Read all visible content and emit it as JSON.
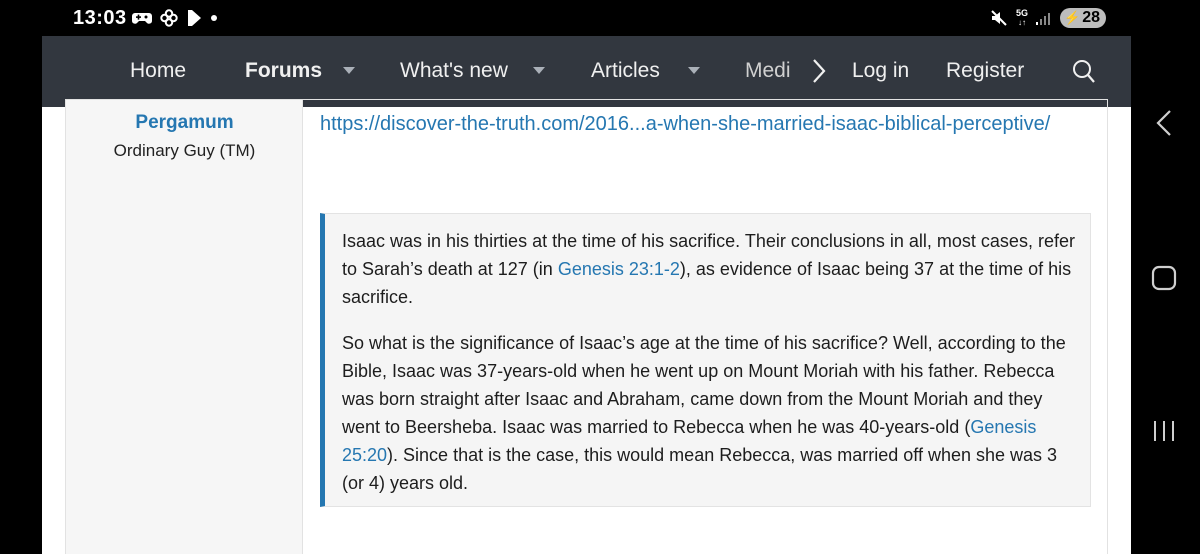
{
  "status_bar": {
    "time": "13:03",
    "notification_icons": [
      "gamepad-icon",
      "pinwheel-icon",
      "play-icon",
      "dot-icon"
    ],
    "network": "5G",
    "battery": "28"
  },
  "nav": {
    "home": "Home",
    "forums": "Forums",
    "whats_new": "What's new",
    "articles": "Articles",
    "media": "Medi",
    "login": "Log in",
    "register": "Register"
  },
  "post": {
    "username": "Pergamum",
    "user_title": "Ordinary Guy (TM)",
    "link_text": "https://discover-the-truth.com/2016...a-when-she-married-isaac-biblical-perceptive/",
    "quote": {
      "p1_a": "Isaac was in his thirties at the time of his sacrifice. Their conclusions in all, most cases, refer to Sarah’s death at 127 (in ",
      "p1_ref": "Genesis 23:1-2",
      "p1_b": "), as evidence of Isaac being 37 at the time of his sacrifice.",
      "p2_a": "So what is the significance of Isaac’s age at the time of his sacrifice? Well, according to the Bible, Isaac was 37-years-old when he went up on Mount Moriah with his father. Rebecca was born straight after Isaac and Abraham, came down from the Mount Moriah and they went to Beersheba. Isaac was married to Rebecca when he was 40-years-old (",
      "p2_ref": "Genesis 25:20",
      "p2_b": "). Since that is the case, this would mean Rebecca, was married off when she was 3 (or 4) years old."
    }
  },
  "colors": {
    "navbar_bg": "#32373f",
    "link": "#2577b1",
    "quote_bg": "#f5f5f5"
  }
}
